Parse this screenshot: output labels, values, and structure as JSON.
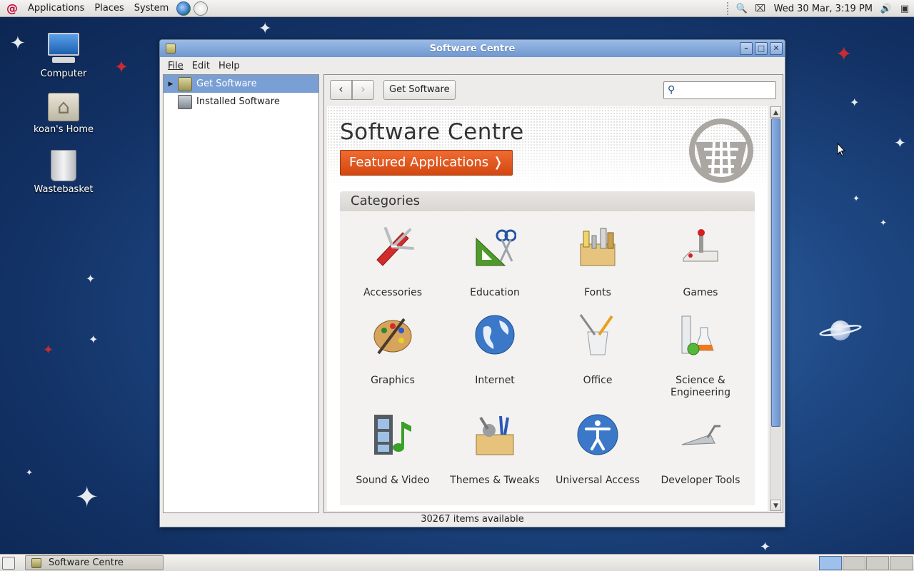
{
  "top_panel": {
    "menus": [
      "Applications",
      "Places",
      "System"
    ],
    "clock": "Wed 30 Mar,  3:19 PM"
  },
  "desktop": {
    "icons": [
      {
        "label": "Computer",
        "icon": "computer-icon"
      },
      {
        "label": "koan's Home",
        "icon": "home-folder-icon"
      },
      {
        "label": "Wastebasket",
        "icon": "trash-icon"
      }
    ]
  },
  "window": {
    "title": "Software Centre",
    "menubar": [
      "File",
      "Edit",
      "Help"
    ],
    "sidebar": [
      {
        "label": "Get Software",
        "icon": "basket-icon",
        "selected": true
      },
      {
        "label": "Installed Software",
        "icon": "monitor-icon",
        "selected": false
      }
    ],
    "toolbar": {
      "back": "‹",
      "forward": "›",
      "breadcrumb": "Get Software",
      "search_value": ""
    },
    "banner": {
      "title": "Software Centre",
      "featured_label": "Featured Applications ❭"
    },
    "categories": {
      "header": "Categories",
      "items": [
        {
          "label": "Accessories",
          "icon": "swiss-knife-icon"
        },
        {
          "label": "Education",
          "icon": "education-icon"
        },
        {
          "label": "Fonts",
          "icon": "fonts-icon"
        },
        {
          "label": "Games",
          "icon": "joystick-icon"
        },
        {
          "label": "Graphics",
          "icon": "palette-icon"
        },
        {
          "label": "Internet",
          "icon": "globe-icon"
        },
        {
          "label": "Office",
          "icon": "pencil-cup-icon"
        },
        {
          "label": "Science & Engineering",
          "icon": "flask-icon"
        },
        {
          "label": "Sound & Video",
          "icon": "film-music-icon"
        },
        {
          "label": "Themes & Tweaks",
          "icon": "toolbox-icon"
        },
        {
          "label": "Universal Access",
          "icon": "accessibility-icon"
        },
        {
          "label": "Developer Tools",
          "icon": "trowel-icon"
        }
      ]
    },
    "status": "30267 items available"
  },
  "bottom_panel": {
    "task": "Software Centre"
  },
  "colors": {
    "accent_orange": "#d34710",
    "selection_blue": "#7a9fd4",
    "titlebar_blue": "#6f97cf"
  }
}
